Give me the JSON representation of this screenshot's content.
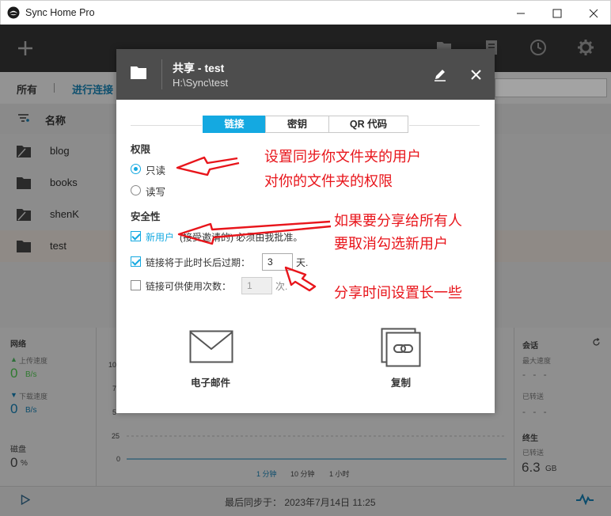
{
  "window": {
    "title": "Sync Home Pro",
    "controls": [
      "minimize-icon",
      "maximize-icon",
      "close-icon"
    ]
  },
  "toolbar": {
    "left_icon": "plus-icon",
    "right_icons": [
      "folder-icon",
      "document-icon",
      "clock-icon",
      "gear-icon"
    ]
  },
  "filter": {
    "all_label": "所有",
    "syncing_label": "进行连接"
  },
  "list": {
    "header_name": "名称",
    "items": [
      {
        "name": "blog",
        "selected": false
      },
      {
        "name": "books",
        "selected": false
      },
      {
        "name": "shenK",
        "selected": false
      },
      {
        "name": "test",
        "selected": true
      }
    ]
  },
  "bottom": {
    "network_title": "网络",
    "upload_label": "上传速度",
    "upload_value": "0",
    "upload_unit": "B/s",
    "download_label": "下载速度",
    "download_value": "0",
    "download_unit": "B/s",
    "disk_title": "磁盘",
    "disk_value": "0",
    "disk_unit": "%",
    "chart_ticks": [
      "10",
      "7",
      "5",
      "25",
      "0"
    ],
    "time_buttons": [
      "1 分钟",
      "10 分钟",
      "1 小时"
    ],
    "session_title": "会话",
    "max_speed_label": "最大速度",
    "sent_label": "已转送",
    "dashes": "- - -",
    "lifetime_title": "终生",
    "lifetime_sent_label": "已转送",
    "lifetime_value": "6.3",
    "lifetime_unit": "GB"
  },
  "status": {
    "last_sync": "最后同步于： 2023年7月14日 11:25"
  },
  "dialog": {
    "title": "共享 - test",
    "path": "H:\\Sync\\test",
    "tabs": [
      {
        "label": "链接",
        "active": true
      },
      {
        "label": "密钥",
        "active": false
      },
      {
        "label": "QR 代码",
        "active": false
      }
    ],
    "permissions_title": "权限",
    "perm_readonly": "只读",
    "perm_readwrite": "读写",
    "security_title": "安全性",
    "new_user_label": "新用户",
    "new_user_note": "(接受邀请的) 必须由我批准。",
    "expire_label": "链接将于此时长后过期：",
    "expire_value": "3",
    "expire_unit": "天.",
    "uses_label": "链接可供使用次数：",
    "uses_value": "1",
    "uses_unit": "次.",
    "email_label": "电子邮件",
    "copy_label": "复制"
  },
  "annotations": {
    "note1_line1": "设置同步你文件夹的用户",
    "note1_line2": "对你的文件夹的权限",
    "note2_line1": "如果要分享给所有人",
    "note2_line2": "要取消勾选新用户",
    "note3": "分享时间设置长一些",
    "color": "#e8151b"
  }
}
